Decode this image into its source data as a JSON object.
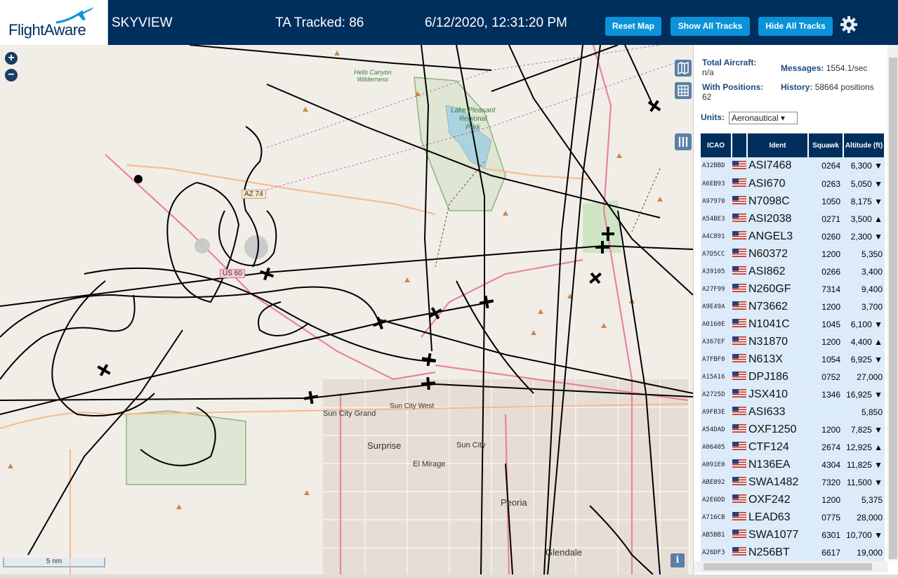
{
  "header": {
    "logo_text": "FlightAware",
    "app_name": "SKYVIEW",
    "tracked": "TA Tracked: 86",
    "datetime": "6/12/2020, 12:31:20 PM",
    "buttons": {
      "reset": "Reset Map",
      "show": "Show All Tracks",
      "hide": "Hide All Tracks"
    }
  },
  "map": {
    "labels": {
      "hells_canyon": "Hells Canyon\nWilderness",
      "lake": "Lake Pleasant\nRegional\nPark",
      "az74": "AZ 74",
      "us60": "US 60",
      "sun_city_grand": "Sun City Grand",
      "sun_city_west": "Sun City West",
      "surprise": "Surprise",
      "sun_city": "Sun City",
      "el_mirage": "El Mirage",
      "peoria": "Peoria",
      "glendale": "Glendale"
    },
    "scale": "5 nm",
    "info": "i"
  },
  "panel": {
    "total_aircraft_label": "Total Aircraft:",
    "total_aircraft_value": "n/a",
    "with_positions_label": "With Positions:",
    "with_positions_value": "62",
    "messages_label": "Messages:",
    "messages_value": "1554.1/sec",
    "history_label": "History:",
    "history_value": "58664 positions",
    "units_label": "Units:",
    "units_value": "Aeronautical",
    "columns": [
      "ICAO",
      "",
      "Ident",
      "Squawk",
      "Altitude (ft)"
    ],
    "rows": [
      {
        "icao": "A32BBD",
        "ident": "ASI7468",
        "squawk": "0264",
        "alt": "6,300 ▼"
      },
      {
        "icao": "A6EB93",
        "ident": "ASI670",
        "squawk": "0263",
        "alt": "5,050 ▼"
      },
      {
        "icao": "A97970",
        "ident": "N7098C",
        "squawk": "1050",
        "alt": "8,175 ▼"
      },
      {
        "icao": "A54BE3",
        "ident": "ASI2038",
        "squawk": "0271",
        "alt": "3,500 ▲"
      },
      {
        "icao": "A4C891",
        "ident": "ANGEL3",
        "squawk": "0260",
        "alt": "2,300 ▼"
      },
      {
        "icao": "A7D5CC",
        "ident": "N60372",
        "squawk": "1200",
        "alt": "5,350"
      },
      {
        "icao": "A39105",
        "ident": "ASI862",
        "squawk": "0266",
        "alt": "3,400"
      },
      {
        "icao": "A27F99",
        "ident": "N260GF",
        "squawk": "7314",
        "alt": "9,400"
      },
      {
        "icao": "A9E49A",
        "ident": "N73662",
        "squawk": "1200",
        "alt": "3,700"
      },
      {
        "icao": "A0160E",
        "ident": "N1041C",
        "squawk": "1045",
        "alt": "6,100 ▼"
      },
      {
        "icao": "A367EF",
        "ident": "N31870",
        "squawk": "1200",
        "alt": "4,400 ▲"
      },
      {
        "icao": "A7FBF0",
        "ident": "N613X",
        "squawk": "1054",
        "alt": "6,925 ▼"
      },
      {
        "icao": "A15A16",
        "ident": "DPJ186",
        "squawk": "0752",
        "alt": "27,000"
      },
      {
        "icao": "A2725D",
        "ident": "JSX410",
        "squawk": "1346",
        "alt": "16,925 ▼"
      },
      {
        "icao": "A9FB3E",
        "ident": "ASI633",
        "squawk": "",
        "alt": "5,850"
      },
      {
        "icao": "A54DAD",
        "ident": "OXF1250",
        "squawk": "1200",
        "alt": "7,825 ▼"
      },
      {
        "icao": "A06405",
        "ident": "CTF124",
        "squawk": "2674",
        "alt": "12,925 ▲"
      },
      {
        "icao": "A091E0",
        "ident": "N136EA",
        "squawk": "4304",
        "alt": "11,825 ▼"
      },
      {
        "icao": "ABE892",
        "ident": "SWA1482",
        "squawk": "7320",
        "alt": "11,500 ▼"
      },
      {
        "icao": "A2E6DD",
        "ident": "OXF242",
        "squawk": "1200",
        "alt": "5,375"
      },
      {
        "icao": "A716CB",
        "ident": "LEAD63",
        "squawk": "0775",
        "alt": "28,000"
      },
      {
        "icao": "AB5BB1",
        "ident": "SWA1077",
        "squawk": "6301",
        "alt": "10,700 ▼"
      },
      {
        "icao": "A26DF3",
        "ident": "N256BT",
        "squawk": "6617",
        "alt": "19,000"
      }
    ]
  }
}
